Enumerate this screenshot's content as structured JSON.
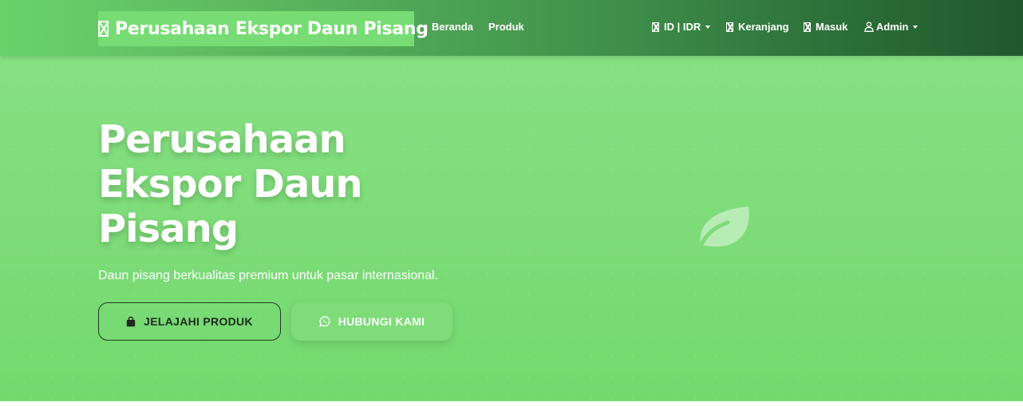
{
  "navbar": {
    "brand": "Perusahaan Ekspor Daun Pisang",
    "links": [
      {
        "label": "Beranda"
      },
      {
        "label": "Produk"
      }
    ],
    "right": {
      "currency": "ID | IDR",
      "cart": "Keranjang",
      "login": "Masuk",
      "user": "Admin"
    }
  },
  "hero": {
    "title": "Perusahaan Ekspor Daun Pisang",
    "subtitle": "Daun pisang berkualitas premium untuk pasar internasional.",
    "primary_button": "JELAJAHI PRODUK",
    "secondary_button": "HUBUNGI KAMI",
    "decor_icon": "leaf-icon"
  },
  "colors": {
    "hero_bg": "#7ddc78",
    "nav_dark": "#21582d",
    "primary_border": "#1d3a21"
  }
}
